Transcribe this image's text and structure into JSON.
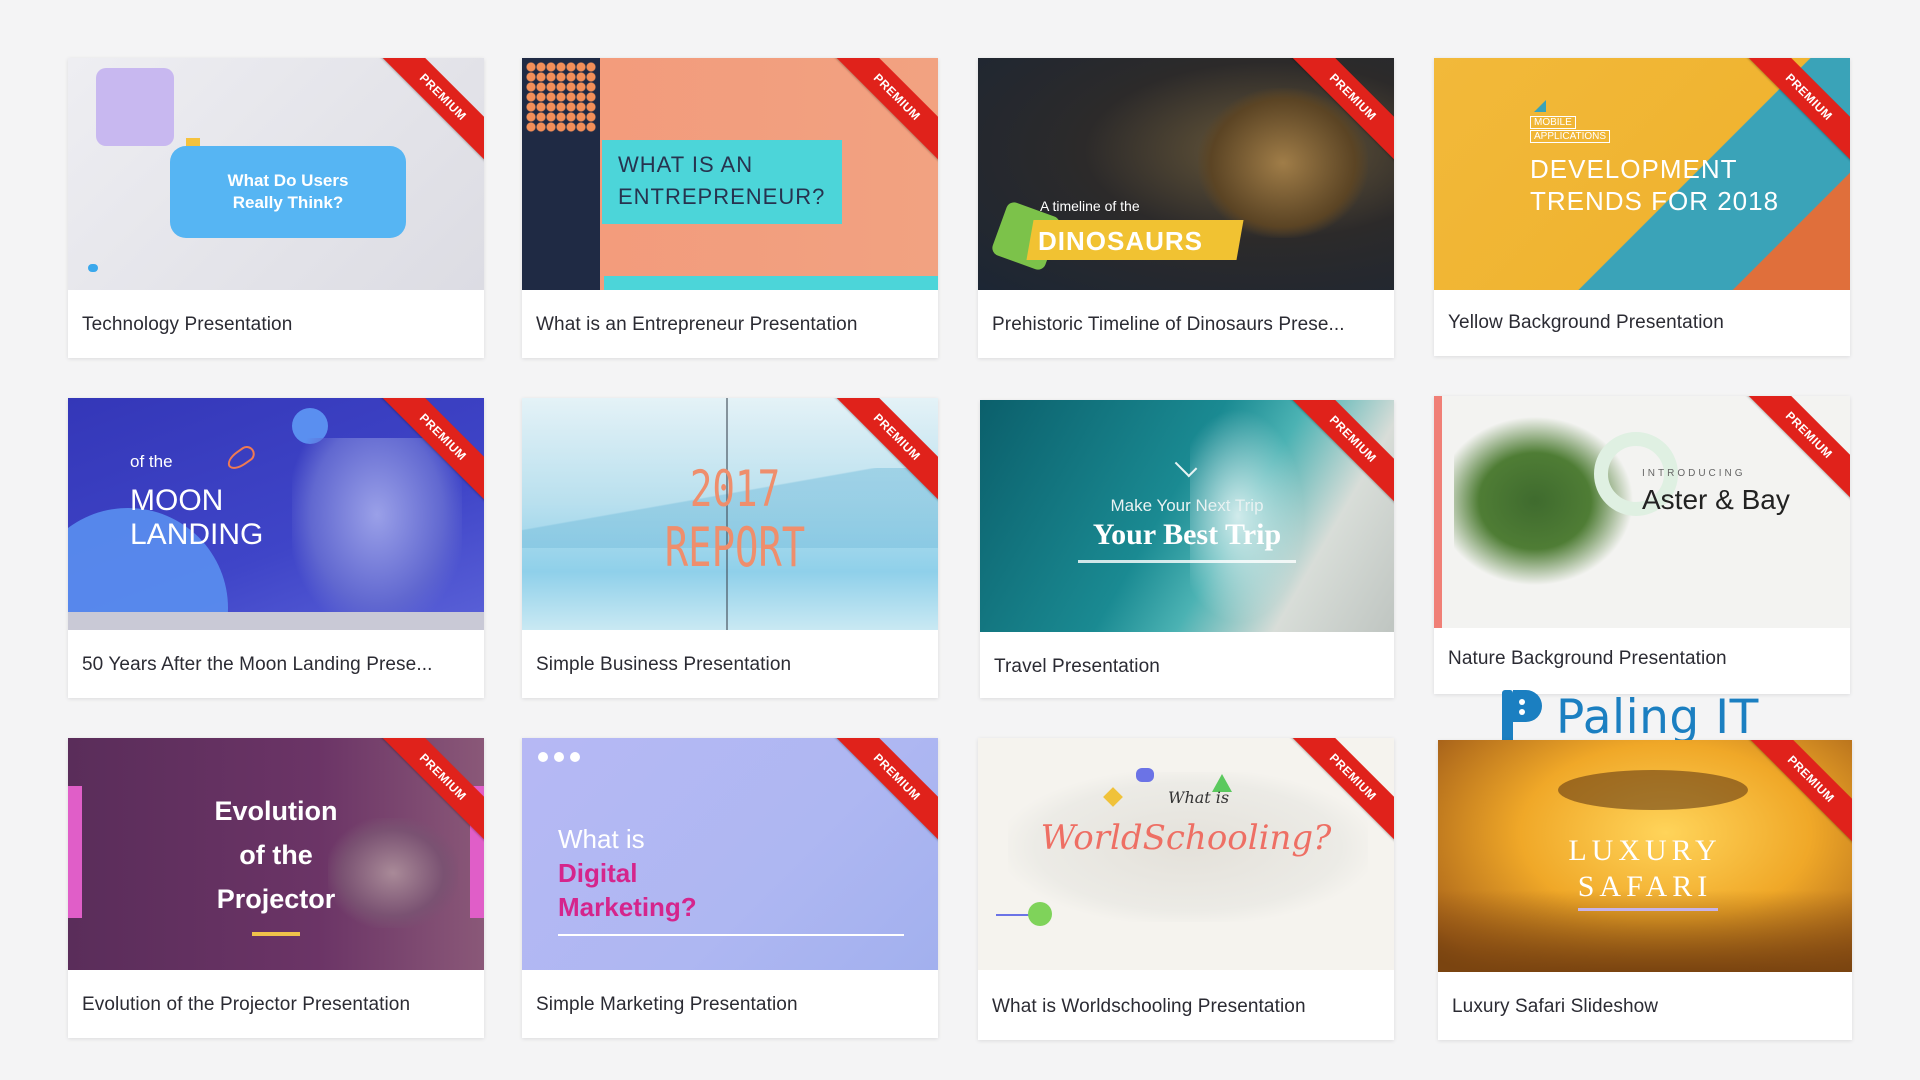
{
  "brand": {
    "name": "Paling IT",
    "color": "#1b7fc1"
  },
  "badge_label": "PREMIUM",
  "cards": [
    {
      "title": "Technology Presentation",
      "thumb": {
        "heading": "What Do Users\nReally Think?"
      }
    },
    {
      "title": "What is an Entrepreneur Presentation",
      "thumb": {
        "heading_line1": "WHAT IS AN",
        "heading_line2": "ENTREPRENEUR?"
      }
    },
    {
      "title": "Prehistoric Timeline of Dinosaurs Prese...",
      "thumb": {
        "sub": "A timeline of the",
        "heading": "DINOSAURS"
      }
    },
    {
      "title": "Yellow Background Presentation",
      "thumb": {
        "tag_line1": "MOBILE",
        "tag_line2": "APPLICATIONS",
        "heading_line1": "DEVELOPMENT",
        "heading_line2": "TRENDS FOR 2018"
      }
    },
    {
      "title": "50 Years After the Moon Landing Prese...",
      "thumb": {
        "sub": "of the",
        "heading_line1": "MOON",
        "heading_line2": "LANDING"
      }
    },
    {
      "title": "Simple Business Presentation",
      "thumb": {
        "heading_line1": "2017",
        "heading_line2": "REPORT"
      }
    },
    {
      "title": "Travel Presentation",
      "thumb": {
        "sub": "Make Your Next Trip",
        "heading": "Your Best Trip"
      }
    },
    {
      "title": "Nature Background Presentation",
      "thumb": {
        "sub": "INTRODUCING",
        "heading": "Aster & Bay"
      }
    },
    {
      "title": "Evolution of the Projector Presentation",
      "thumb": {
        "heading_line1": "Evolution",
        "heading_line2": "of the",
        "heading_line3": "Projector"
      }
    },
    {
      "title": "Simple Marketing Presentation",
      "thumb": {
        "heading_line1": "What is",
        "heading_line2": "Digital",
        "heading_line3": "Marketing?"
      }
    },
    {
      "title": "What is Worldschooling Presentation",
      "thumb": {
        "sub": "What is",
        "heading": "WorldSchooling?"
      }
    },
    {
      "title": "Luxury Safari Slideshow",
      "thumb": {
        "heading_line1": "LUXURY",
        "heading_line2": "SAFARI"
      }
    }
  ]
}
